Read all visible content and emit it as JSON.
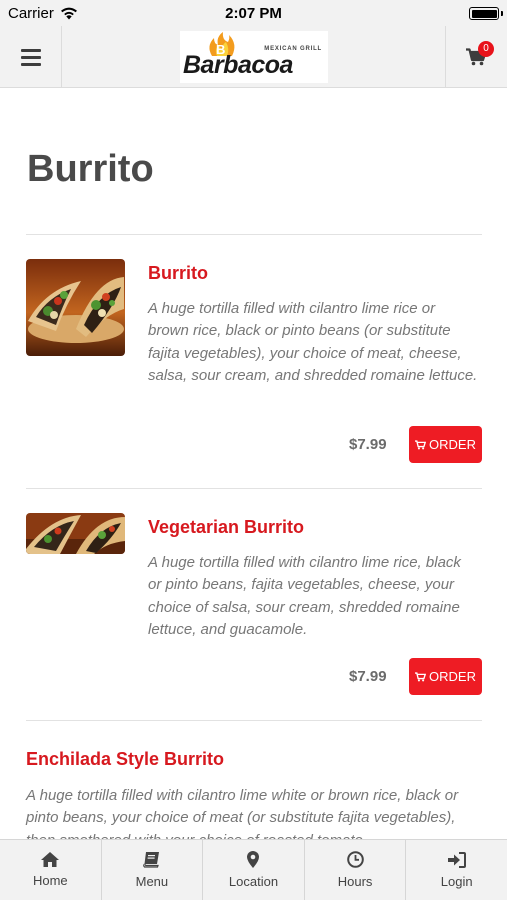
{
  "status_bar": {
    "carrier": "Carrier",
    "time": "2:07 PM",
    "battery_level": 1.0
  },
  "header": {
    "menu_icon": "hamburger-icon",
    "logo": {
      "word": "Barbacoa",
      "tagline": "MEXICAN GRILL"
    },
    "cart_icon": "cart-icon",
    "cart_count": "0"
  },
  "page": {
    "title": "Burrito"
  },
  "items": [
    {
      "name": "Burrito",
      "description": "A huge tortilla filled with cilantro lime rice or brown rice, black or pinto beans (or substitute fajita vegetables), your choice of meat, cheese, salsa, sour cream, and shredded romaine lettuce.",
      "price": "$7.99",
      "order_label": "ORDER",
      "has_image": true
    },
    {
      "name": "Vegetarian Burrito",
      "description": "A huge tortilla filled with cilantro lime rice, black or pinto beans, fajita vegetables, cheese, your choice of salsa, sour cream, shredded romaine lettuce, and guacamole.",
      "price": "$7.99",
      "order_label": "ORDER",
      "has_image": true
    },
    {
      "name": "Enchilada Style Burrito",
      "description": "A huge tortilla filled with cilantro lime white or brown rice, black or pinto beans, your choice of meat (or substitute fajita vegetables), then smothered with your choice of roasted tomato",
      "has_image": false
    }
  ],
  "tabs": [
    {
      "label": "Home",
      "icon": "home-icon"
    },
    {
      "label": "Menu",
      "icon": "book-icon"
    },
    {
      "label": "Location",
      "icon": "map-pin-icon"
    },
    {
      "label": "Hours",
      "icon": "clock-icon"
    },
    {
      "label": "Login",
      "icon": "login-icon"
    }
  ],
  "colors": {
    "accent_red": "#ee1c24",
    "item_name_red": "#d7191f",
    "bar_background": "#f2f2f2",
    "logo_flame_orange": "#f39c1e"
  }
}
